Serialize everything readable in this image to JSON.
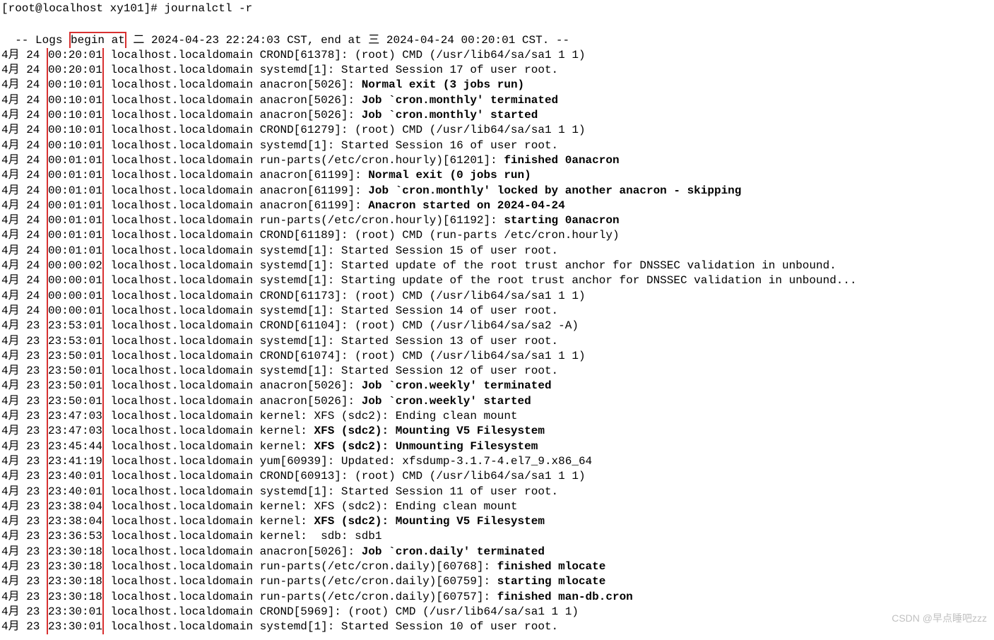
{
  "prompt": "[root@localhost xy101]# journalctl -r",
  "header": "-- Logs begin at 二 2024-04-23 22:24:03 CST, end at 三 2024-04-24 00:20:01 CST. --",
  "host": "localhost.localdomain",
  "watermark": "CSDN @早点睡吧zzz",
  "entries": [
    {
      "date": "4月 24",
      "time": "00:20:01",
      "proc": "CROND[61378]: ",
      "msg": "(root) CMD (/usr/lib64/sa/sa1 1 1)",
      "bold": false
    },
    {
      "date": "4月 24",
      "time": "00:20:01",
      "proc": "systemd[1]: ",
      "msg": "Started Session 17 of user root.",
      "bold": false
    },
    {
      "date": "4月 24",
      "time": "00:10:01",
      "proc": "anacron[5026]: ",
      "msg": "Normal exit (3 jobs run)",
      "bold": true
    },
    {
      "date": "4月 24",
      "time": "00:10:01",
      "proc": "anacron[5026]: ",
      "msg": "Job `cron.monthly' terminated",
      "bold": true
    },
    {
      "date": "4月 24",
      "time": "00:10:01",
      "proc": "anacron[5026]: ",
      "msg": "Job `cron.monthly' started",
      "bold": true
    },
    {
      "date": "4月 24",
      "time": "00:10:01",
      "proc": "CROND[61279]: ",
      "msg": "(root) CMD (/usr/lib64/sa/sa1 1 1)",
      "bold": false
    },
    {
      "date": "4月 24",
      "time": "00:10:01",
      "proc": "systemd[1]: ",
      "msg": "Started Session 16 of user root.",
      "bold": false
    },
    {
      "date": "4月 24",
      "time": "00:01:01",
      "proc": "run-parts(/etc/cron.hourly)[61201]: ",
      "msg": "finished 0anacron",
      "bold": true
    },
    {
      "date": "4月 24",
      "time": "00:01:01",
      "proc": "anacron[61199]: ",
      "msg": "Normal exit (0 jobs run)",
      "bold": true
    },
    {
      "date": "4月 24",
      "time": "00:01:01",
      "proc": "anacron[61199]: ",
      "msg": "Job `cron.monthly' locked by another anacron - skipping",
      "bold": true
    },
    {
      "date": "4月 24",
      "time": "00:01:01",
      "proc": "anacron[61199]: ",
      "msg": "Anacron started on 2024-04-24",
      "bold": true
    },
    {
      "date": "4月 24",
      "time": "00:01:01",
      "proc": "run-parts(/etc/cron.hourly)[61192]: ",
      "msg": "starting 0anacron",
      "bold": true
    },
    {
      "date": "4月 24",
      "time": "00:01:01",
      "proc": "CROND[61189]: ",
      "msg": "(root) CMD (run-parts /etc/cron.hourly)",
      "bold": false
    },
    {
      "date": "4月 24",
      "time": "00:01:01",
      "proc": "systemd[1]: ",
      "msg": "Started Session 15 of user root.",
      "bold": false
    },
    {
      "date": "4月 24",
      "time": "00:00:02",
      "proc": "systemd[1]: ",
      "msg": "Started update of the root trust anchor for DNSSEC validation in unbound.",
      "bold": false
    },
    {
      "date": "4月 24",
      "time": "00:00:01",
      "proc": "systemd[1]: ",
      "msg": "Starting update of the root trust anchor for DNSSEC validation in unbound...",
      "bold": false
    },
    {
      "date": "4月 24",
      "time": "00:00:01",
      "proc": "CROND[61173]: ",
      "msg": "(root) CMD (/usr/lib64/sa/sa1 1 1)",
      "bold": false
    },
    {
      "date": "4月 24",
      "time": "00:00:01",
      "proc": "systemd[1]: ",
      "msg": "Started Session 14 of user root.",
      "bold": false
    },
    {
      "date": "4月 23",
      "time": "23:53:01",
      "proc": "CROND[61104]: ",
      "msg": "(root) CMD (/usr/lib64/sa/sa2 -A)",
      "bold": false
    },
    {
      "date": "4月 23",
      "time": "23:53:01",
      "proc": "systemd[1]: ",
      "msg": "Started Session 13 of user root.",
      "bold": false
    },
    {
      "date": "4月 23",
      "time": "23:50:01",
      "proc": "CROND[61074]: ",
      "msg": "(root) CMD (/usr/lib64/sa/sa1 1 1)",
      "bold": false
    },
    {
      "date": "4月 23",
      "time": "23:50:01",
      "proc": "systemd[1]: ",
      "msg": "Started Session 12 of user root.",
      "bold": false
    },
    {
      "date": "4月 23",
      "time": "23:50:01",
      "proc": "anacron[5026]: ",
      "msg": "Job `cron.weekly' terminated",
      "bold": true
    },
    {
      "date": "4月 23",
      "time": "23:50:01",
      "proc": "anacron[5026]: ",
      "msg": "Job `cron.weekly' started",
      "bold": true
    },
    {
      "date": "4月 23",
      "time": "23:47:03",
      "proc": "kernel: ",
      "msg": "XFS (sdc2): Ending clean mount",
      "bold": false
    },
    {
      "date": "4月 23",
      "time": "23:47:03",
      "proc": "kernel: ",
      "msg": "XFS (sdc2): Mounting V5 Filesystem",
      "bold": true
    },
    {
      "date": "4月 23",
      "time": "23:45:44",
      "proc": "kernel: ",
      "msg": "XFS (sdc2): Unmounting Filesystem",
      "bold": true
    },
    {
      "date": "4月 23",
      "time": "23:41:19",
      "proc": "yum[60939]: ",
      "msg": "Updated: xfsdump-3.1.7-4.el7_9.x86_64",
      "bold": false
    },
    {
      "date": "4月 23",
      "time": "23:40:01",
      "proc": "CROND[60913]: ",
      "msg": "(root) CMD (/usr/lib64/sa/sa1 1 1)",
      "bold": false
    },
    {
      "date": "4月 23",
      "time": "23:40:01",
      "proc": "systemd[1]: ",
      "msg": "Started Session 11 of user root.",
      "bold": false
    },
    {
      "date": "4月 23",
      "time": "23:38:04",
      "proc": "kernel: ",
      "msg": "XFS (sdc2): Ending clean mount",
      "bold": false
    },
    {
      "date": "4月 23",
      "time": "23:38:04",
      "proc": "kernel: ",
      "msg": "XFS (sdc2): Mounting V5 Filesystem",
      "bold": true
    },
    {
      "date": "4月 23",
      "time": "23:36:53",
      "proc": "kernel:  ",
      "msg": "sdb: sdb1",
      "bold": false
    },
    {
      "date": "4月 23",
      "time": "23:30:18",
      "proc": "anacron[5026]: ",
      "msg": "Job `cron.daily' terminated",
      "bold": true
    },
    {
      "date": "4月 23",
      "time": "23:30:18",
      "proc": "run-parts(/etc/cron.daily)[60768]: ",
      "msg": "finished mlocate",
      "bold": true
    },
    {
      "date": "4月 23",
      "time": "23:30:18",
      "proc": "run-parts(/etc/cron.daily)[60759]: ",
      "msg": "starting mlocate",
      "bold": true
    },
    {
      "date": "4月 23",
      "time": "23:30:18",
      "proc": "run-parts(/etc/cron.daily)[60757]: ",
      "msg": "finished man-db.cron",
      "bold": true
    },
    {
      "date": "4月 23",
      "time": "23:30:01",
      "proc": "CROND[5969]: ",
      "msg": "(root) CMD (/usr/lib64/sa/sa1 1 1)",
      "bold": false
    },
    {
      "date": "4月 23",
      "time": "23:30:01",
      "proc": "systemd[1]: ",
      "msg": "Started Session 10 of user root.",
      "bold": false
    }
  ]
}
